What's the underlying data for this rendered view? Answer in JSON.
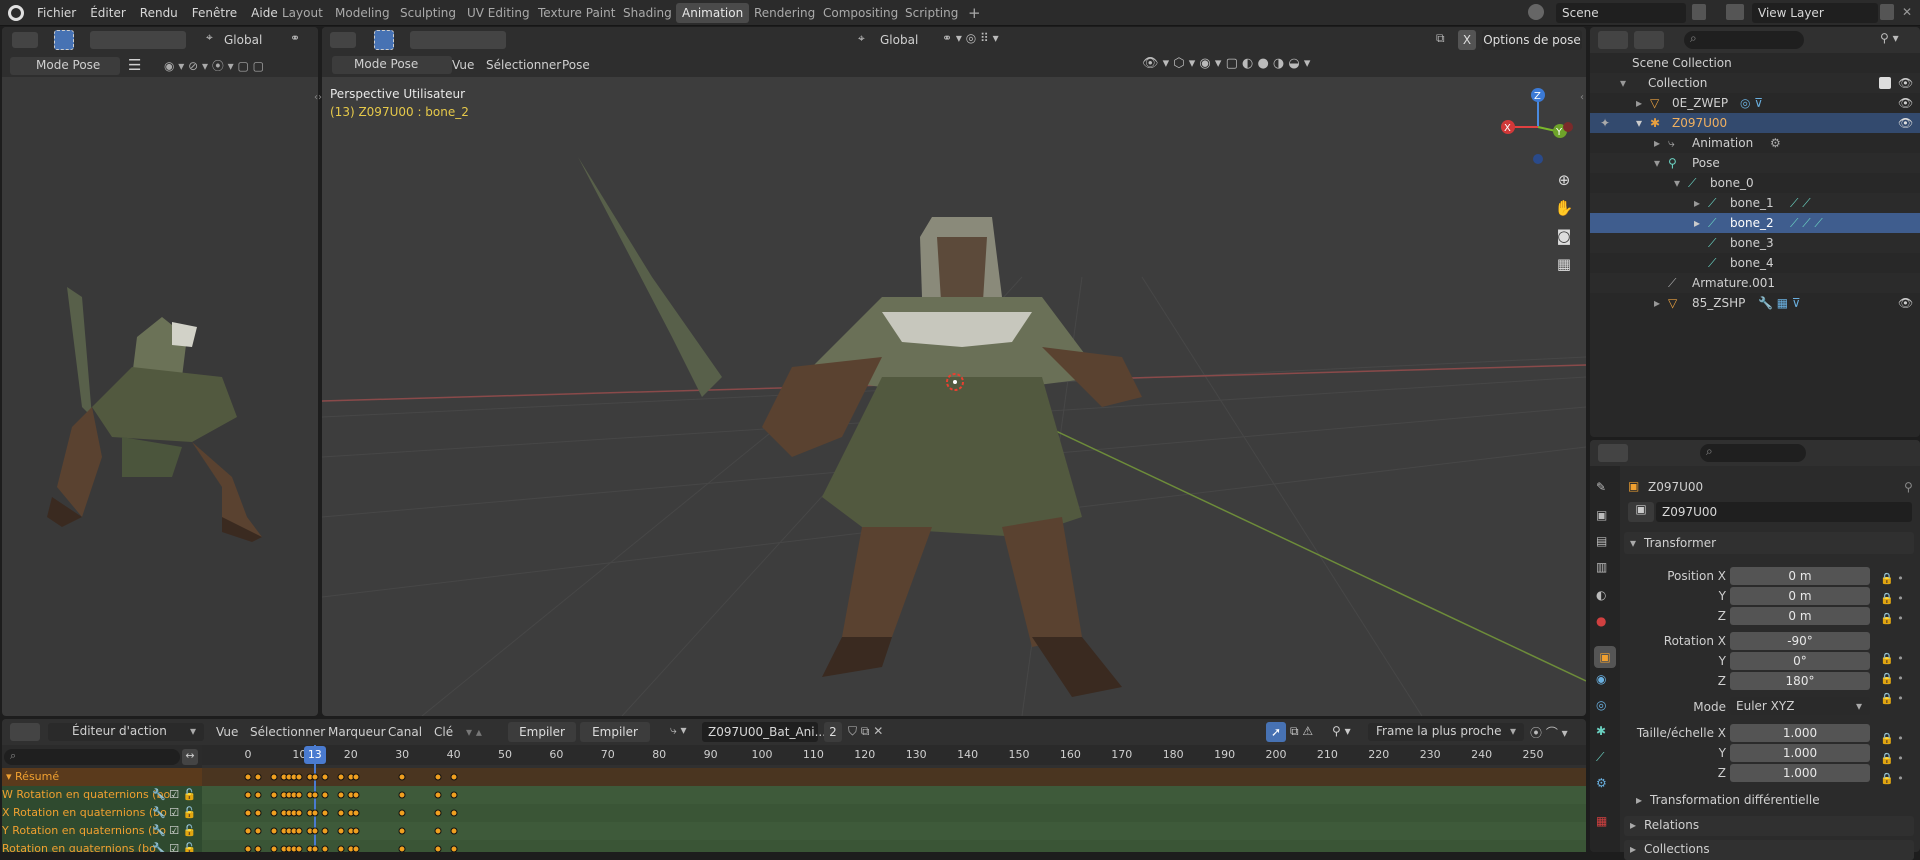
{
  "menu": [
    "Fichier",
    "Éditer",
    "Rendu",
    "Fenêtre",
    "Aide"
  ],
  "workspaces": [
    "Layout",
    "Modeling",
    "Sculpting",
    "UV Editing",
    "Texture Paint",
    "Shading",
    "Animation",
    "Rendering",
    "Compositing",
    "Scripting"
  ],
  "active_workspace": "Animation",
  "scene": {
    "name": "Scene",
    "view_layer": "View Layer"
  },
  "left_view": {
    "mode": "Mode Pose",
    "transform": "Global"
  },
  "viewport": {
    "mode": "Mode Pose",
    "menus": [
      "Vue",
      "Sélectionner",
      "Pose"
    ],
    "transform": "Global",
    "options_label": "Options de pose",
    "x_label": "X",
    "title": "Perspective Utilisateur",
    "subtitle": "(13) Z097U00 : bone_2",
    "gizmo": {
      "x": "X",
      "y": "Y",
      "z": "Z"
    }
  },
  "outliner": {
    "rows": [
      {
        "label": "Scene Collection",
        "indent": 0
      },
      {
        "label": "Collection",
        "indent": 1
      },
      {
        "label": "0E_ZWEP",
        "indent": 2
      },
      {
        "label": "Z097U00",
        "indent": 2
      },
      {
        "label": "Animation",
        "indent": 3
      },
      {
        "label": "Pose",
        "indent": 3
      },
      {
        "label": "bone_0",
        "indent": 4
      },
      {
        "label": "bone_1",
        "indent": 5
      },
      {
        "label": "bone_2",
        "indent": 5
      },
      {
        "label": "bone_3",
        "indent": 5
      },
      {
        "label": "bone_4",
        "indent": 5
      },
      {
        "label": "Armature.001",
        "indent": 3
      },
      {
        "label": "85_ZSHP",
        "indent": 2
      }
    ]
  },
  "properties": {
    "object_name": "Z097U00",
    "data_name": "Z097U00",
    "section": "Transformer",
    "position_label": "Position X",
    "rotation_label": "Rotation X",
    "scale_label": "Taille/échelle X",
    "y": "Y",
    "z": "Z",
    "position": [
      "0 m",
      "0 m",
      "0 m"
    ],
    "rotation": [
      "-90°",
      "0°",
      "180°"
    ],
    "mode_label": "Mode",
    "mode": "Euler XYZ",
    "scale": [
      "1.000",
      "1.000",
      "1.000"
    ],
    "delta": "Transformation différentielle",
    "relations": "Relations",
    "collections": "Collections"
  },
  "action_editor": {
    "editor": "Éditeur d'action",
    "menus": [
      "Vue",
      "Sélectionner",
      "Marqueur",
      "Canal",
      "Clé"
    ],
    "push_down": "Empiler",
    "stash": "Empiler",
    "action": "Z097U00_Bat_Ani...",
    "users": "2",
    "snap": "Frame la plus proche",
    "current_frame": "13",
    "ticks": [
      "0",
      "10",
      "20",
      "30",
      "40",
      "50",
      "60",
      "70",
      "80",
      "90",
      "100",
      "110",
      "120",
      "130",
      "140",
      "150",
      "160",
      "170",
      "180",
      "190",
      "200",
      "210",
      "220",
      "230",
      "240",
      "250"
    ],
    "summary": "Résumé",
    "channels": [
      "W Rotation en quaternions (bo",
      "X Rotation en quaternions (bo",
      "Y Rotation en quaternions (bo",
      "Rotation en quaternions (bo"
    ],
    "keyframes": [
      0,
      2,
      5,
      7,
      8,
      9,
      10,
      12,
      13,
      15,
      18,
      20,
      21,
      30,
      37,
      40
    ]
  }
}
